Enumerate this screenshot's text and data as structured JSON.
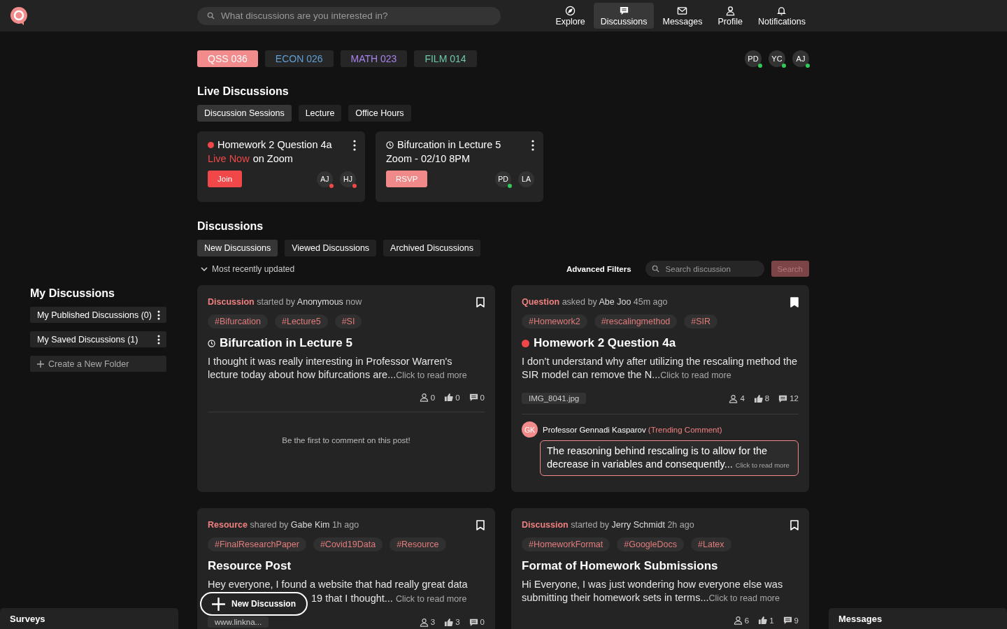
{
  "header": {
    "search": {
      "placeholder": "What discussions are you interested in?"
    },
    "nav": [
      {
        "label": "Explore",
        "selected": false
      },
      {
        "label": "Discussions",
        "selected": true
      },
      {
        "label": "Messages",
        "selected": false
      },
      {
        "label": "Profile",
        "selected": false
      },
      {
        "label": "Notifications",
        "selected": false
      }
    ]
  },
  "courses": [
    {
      "label": "QSS 036",
      "color": "#f28b8b",
      "selected": true
    },
    {
      "label": "ECON 026",
      "color": "#5f9fd6",
      "selected": false
    },
    {
      "label": "MATH 023",
      "color": "#a982ee",
      "selected": false
    },
    {
      "label": "FILM 014",
      "color": "#6cc9a8",
      "selected": false
    }
  ],
  "online_users": [
    {
      "initials": "PD",
      "color": "#34c759"
    },
    {
      "initials": "YC",
      "color": "#34c759"
    },
    {
      "initials": "AJ",
      "color": "#34c759"
    }
  ],
  "sidebar": {
    "heading": "My Discussions",
    "folders": [
      {
        "label": "My Published Discussions (0)"
      },
      {
        "label": "My Saved Discussions (1)"
      }
    ],
    "create": "Create a New Folder"
  },
  "live": {
    "heading": "Live Discussions",
    "filters": [
      {
        "label": "Discussion Sessions",
        "selected": true
      },
      {
        "label": "Lecture",
        "selected": false
      },
      {
        "label": "Office Hours",
        "selected": false
      }
    ],
    "cards": [
      {
        "kind": "live",
        "title": "Homework 2 Question 4a",
        "status": "Live Now",
        "detail": "on Zoom",
        "button": "Join",
        "attendees": [
          {
            "initials": "AJ",
            "color": "#f04848"
          },
          {
            "initials": "HJ",
            "color": "#f04848"
          }
        ]
      },
      {
        "kind": "scheduled",
        "title": "Bifurcation in Lecture 5",
        "detail": "Zoom - 02/10 8PM",
        "button": "RSVP",
        "attendees": [
          {
            "initials": "PD",
            "color": "#34c759"
          },
          {
            "initials": "LA"
          }
        ]
      }
    ]
  },
  "discussions": {
    "heading": "Discussions",
    "tabs": [
      {
        "label": "New Discussions",
        "selected": true
      },
      {
        "label": "Viewed Discussions",
        "selected": false
      },
      {
        "label": "Archived Discussions",
        "selected": false
      }
    ],
    "sort": "Most recently updated",
    "advanced_filters": "Advanced Filters",
    "search": {
      "placeholder": "Search discussion"
    },
    "search_button": {
      "label": "Search",
      "disabled": true
    },
    "posts": [
      {
        "type": "Discussion",
        "verb": "started by",
        "author": "Anonymous",
        "time": "now",
        "saved": false,
        "tags": [
          "#Bifurcation",
          "#Lecture5",
          "#SI"
        ],
        "kind": "scheduled",
        "title": "Bifurcation in Lecture 5",
        "body": "I thought it was really interesting in Professor Warren's lecture today about how bifurcations are...",
        "more": "Click to read more",
        "stats": {
          "people": "0",
          "likes": "0",
          "comments": "0"
        },
        "empty_comments": "Be the first to comment on this post!"
      },
      {
        "type": "Question",
        "verb": "asked by",
        "author": "Abe Joo",
        "time": "45m ago",
        "saved": true,
        "tags": [
          "#Homework2",
          "#rescalingmethod",
          "#SIR"
        ],
        "kind": "live",
        "title": "Homework 2 Question 4a",
        "body": "I don’t understand why after utilizing the rescaling method the SIR model can remove the N...",
        "more": "Click to read more",
        "attachment": "IMG_8041.jpg",
        "stats": {
          "people": "4",
          "likes": "8",
          "comments": "12"
        },
        "trending": {
          "initials": "GK",
          "author": "Professor Gennadi Kasparov",
          "label": "(Trending Comment)",
          "text": "The reasoning behind rescaling is to allow for the decrease in variables and consequently...",
          "more": "Click to read more"
        }
      },
      {
        "type": "Resource",
        "verb": "shared by",
        "author": "Gabe Kim",
        "time": "1h ago",
        "saved": false,
        "tags": [
          "#FinalResearchPaper",
          "#Covid19Data",
          "#Resource"
        ],
        "title": "Resource Post",
        "body": "Hey everyone, I found a website that had really great data",
        "body_continued": "19 that I thought...",
        "more": "Click to read more",
        "attachment": "www.linkna...",
        "stats": {
          "people": "3",
          "likes": "3",
          "comments": "0"
        }
      },
      {
        "type": "Discussion",
        "verb": "started by",
        "author": "Jerry Schmidt",
        "time": "2h ago",
        "saved": false,
        "tags": [
          "#HomeworkFormat",
          "#GoogleDocs",
          "#Latex"
        ],
        "title": "Format of Homework Submissions",
        "body": "Hi Everyone, I was just wondering how everyone else was submitting their homework sets in terms...",
        "more": "Click to read more",
        "stats": {
          "people": "6",
          "likes": "1",
          "comments": "9"
        }
      }
    ]
  },
  "new_discussion_button": "New Discussion",
  "docks": {
    "surveys": "Surveys",
    "messages": "Messages"
  }
}
